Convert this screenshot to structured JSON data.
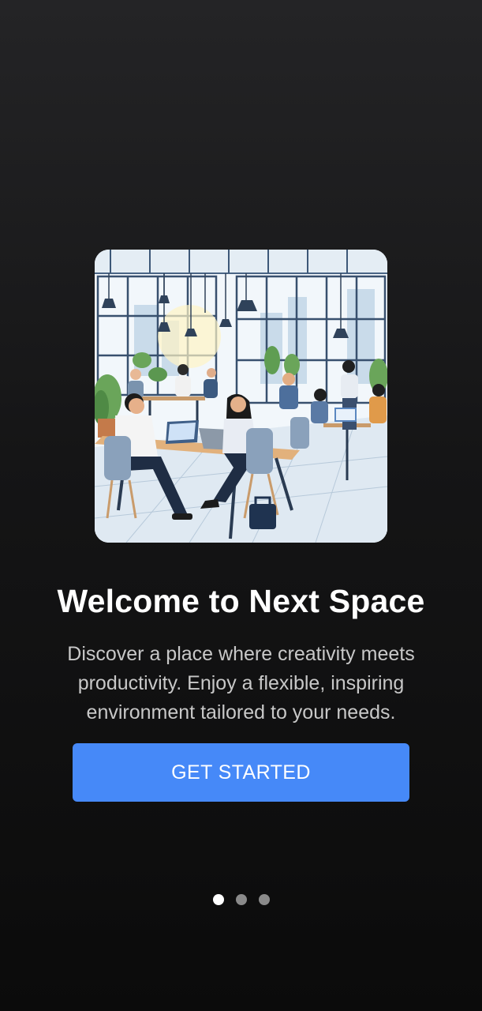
{
  "onboarding": {
    "title": "Welcome to Next Space",
    "description": "Discover a place where creativity meets productivity. Enjoy a flexible, inspiring environment tailored to your needs.",
    "cta_label": "GET STARTED",
    "hero_image": "coworking-space-illustration"
  },
  "pagination": {
    "total": 3,
    "active_index": 0
  },
  "colors": {
    "accent": "#4689f8",
    "background_top": "#242426",
    "background_bottom": "#0b0b0b",
    "dot_active": "#ffffff",
    "dot_inactive": "#8a8a8a"
  }
}
